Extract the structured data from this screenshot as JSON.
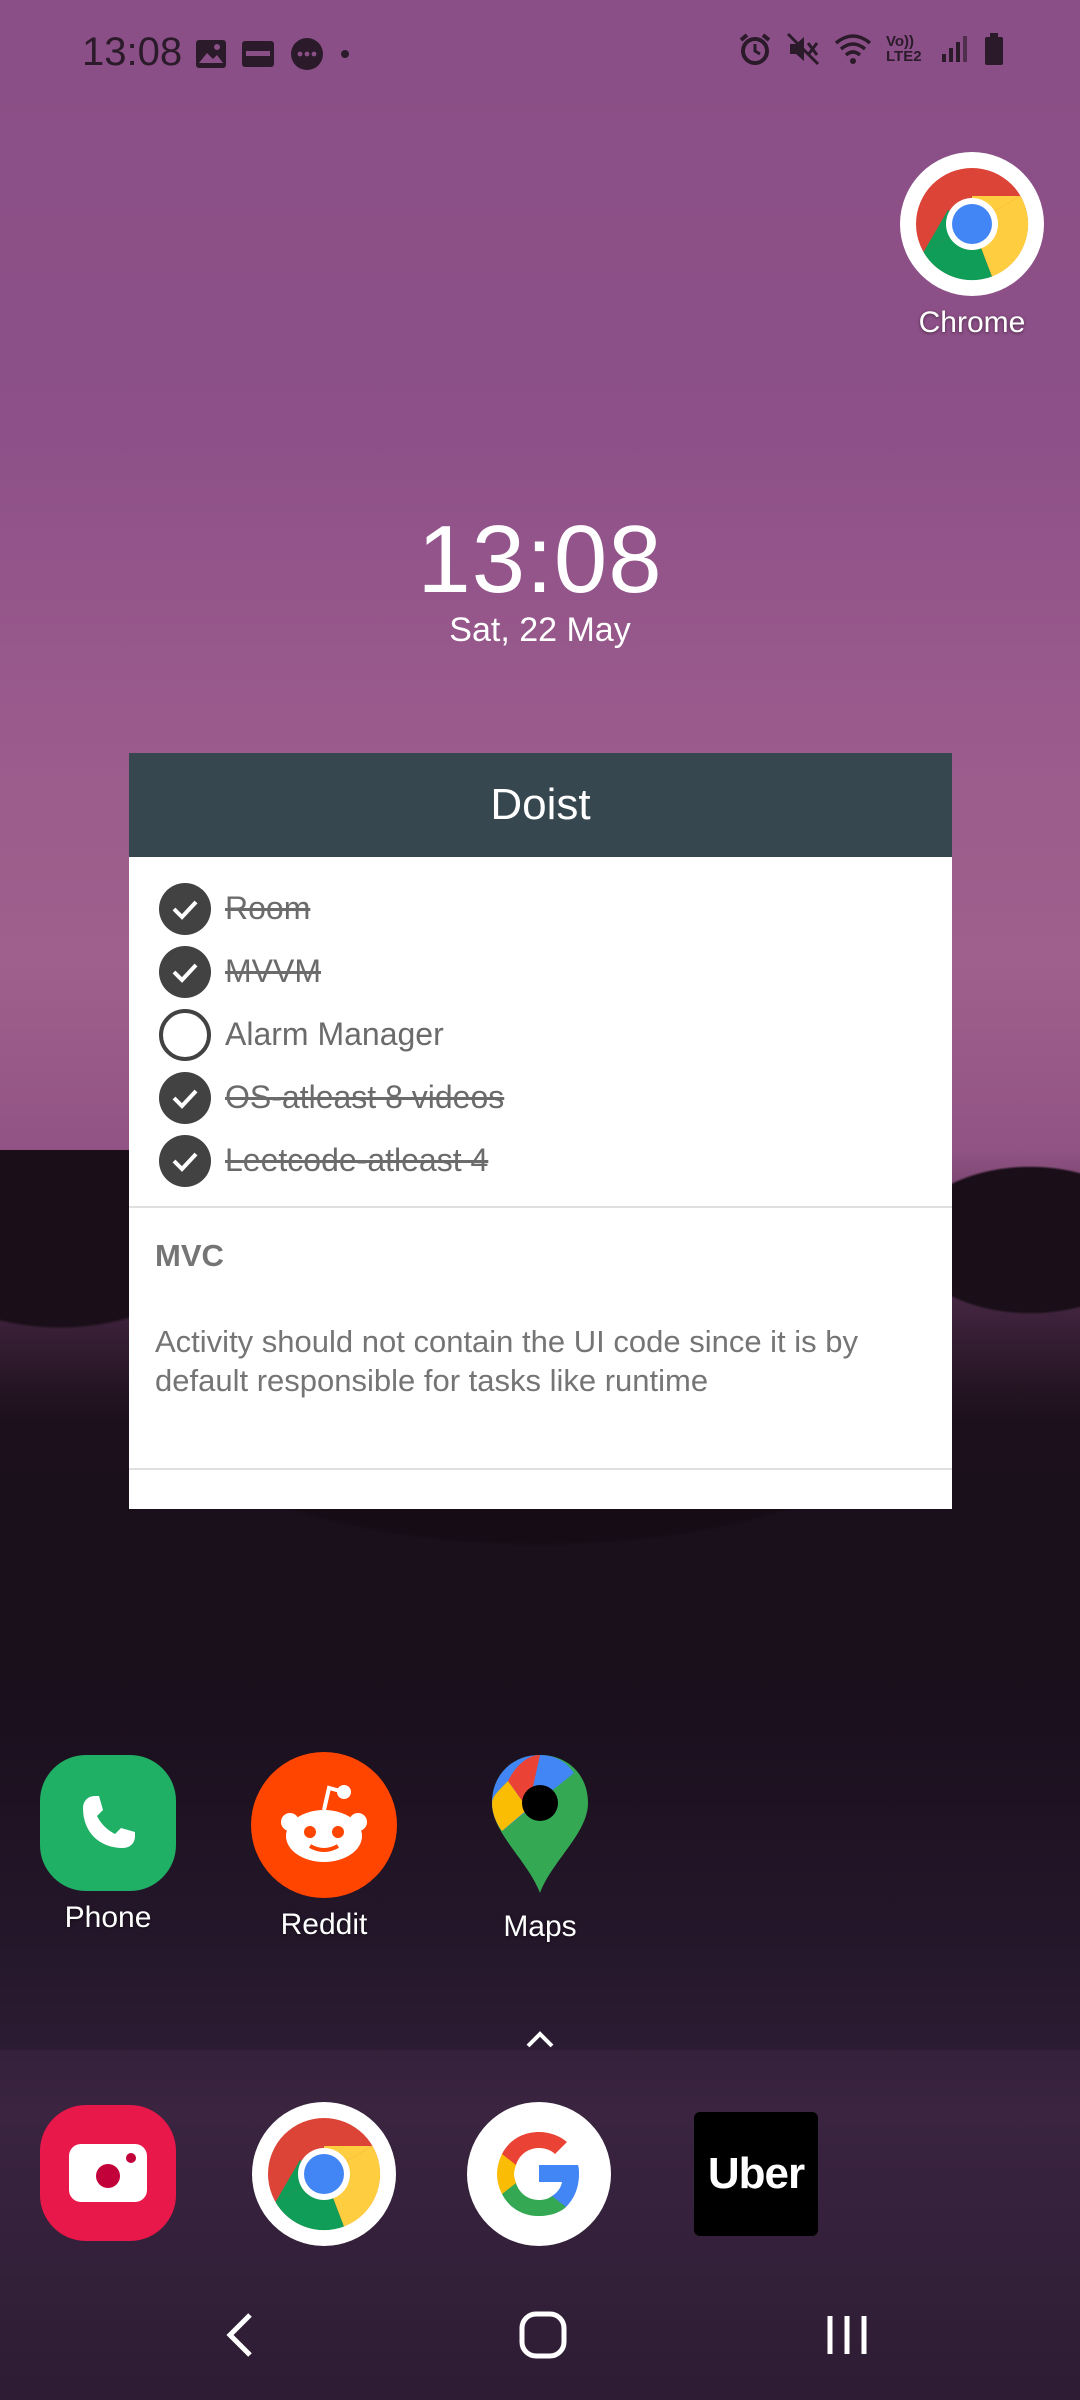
{
  "status_bar": {
    "time": "13:08",
    "network_text": "Vo)) LTE2"
  },
  "apps": {
    "chrome_top": {
      "label": "Chrome"
    },
    "row": [
      {
        "label": "Phone"
      },
      {
        "label": "Reddit"
      },
      {
        "label": "Maps"
      }
    ]
  },
  "clock": {
    "time": "13:08",
    "date": "Sat, 22 May"
  },
  "widget": {
    "title": "Doist",
    "tasks": [
      {
        "label": "Room",
        "done": true
      },
      {
        "label": "MVVM",
        "done": true
      },
      {
        "label": "Alarm Manager",
        "done": false
      },
      {
        "label": "OS-atleast 8 videos",
        "done": true
      },
      {
        "label": "Leetcode-atleast 4",
        "done": true
      }
    ],
    "note": {
      "title": "MVC",
      "body": "Activity should not contain the UI code since it is by default responsible for tasks like runtime"
    }
  },
  "dock": {
    "apps": [
      "Screen Recorder",
      "Chrome",
      "Google",
      "Uber"
    ],
    "uber_text": "Uber"
  },
  "colors": {
    "widget_header": "#37474f",
    "phone_green": "#1fb065",
    "reddit_orange": "#ff4500",
    "recorder_red": "#e8184a"
  }
}
